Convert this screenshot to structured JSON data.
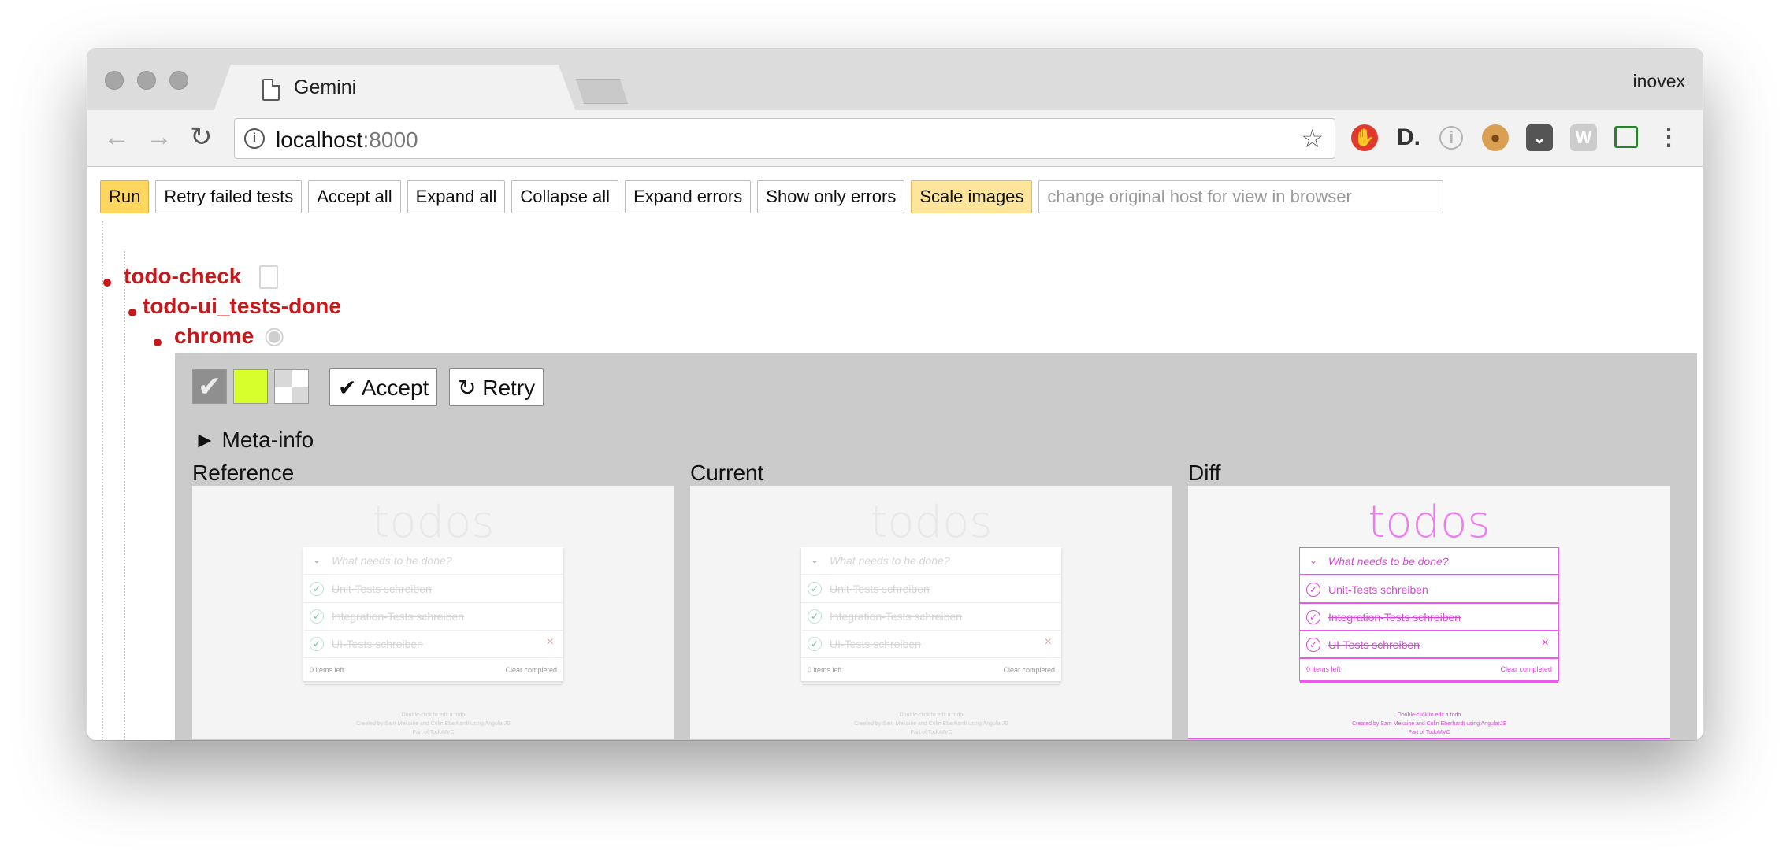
{
  "browser": {
    "tab_title": "Gemini",
    "profile": "inovex",
    "url_host": "localhost",
    "url_port": ":8000"
  },
  "controls": {
    "run": "Run",
    "retry_failed": "Retry failed tests",
    "accept_all": "Accept all",
    "expand_all": "Expand all",
    "collapse_all": "Collapse all",
    "expand_errors": "Expand errors",
    "show_only_errors": "Show only errors",
    "scale_images": "Scale images",
    "host_placeholder": "change original host for view in browser"
  },
  "tree": {
    "suite": "todo-check",
    "state": "todo-ui_tests-done",
    "browser": "chrome"
  },
  "result": {
    "accept": "✔ Accept",
    "retry": "↻ Retry",
    "meta_info": "► Meta-info",
    "columns": [
      "Reference",
      "Current",
      "Diff"
    ]
  },
  "todo_app": {
    "title": "todos",
    "placeholder": "What needs to be done?",
    "items": [
      "Unit-Tests schreiben",
      "Integration-Tests schreiben",
      "UI-Tests schreiben"
    ],
    "items_left": "0 items left",
    "clear_completed": "Clear completed",
    "footer": [
      "Double-click to edit a todo",
      "Created by Sam Mekaine and Colin Eberhardt using AngularJS",
      "Part of TodoMVC"
    ]
  },
  "colors": {
    "accent_red": "#c9171a",
    "run_yellow": "#ffd75e",
    "diff_magenta": "#e85ae8",
    "swatch_lime": "#d6ff2c"
  }
}
